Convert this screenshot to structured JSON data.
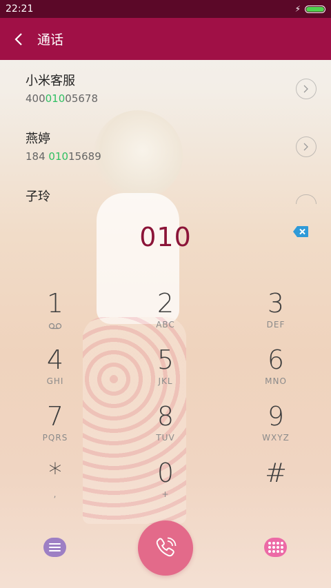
{
  "status_bar": {
    "time": "22:21",
    "charging_icon": "bolt-icon",
    "battery_icon": "battery-icon",
    "battery_color": "#4fd14f"
  },
  "title_bar": {
    "back_icon": "chevron-left-icon",
    "title": "通话",
    "color": "#a01046"
  },
  "results": [
    {
      "name": "小米客服",
      "number_pre": "400",
      "number_match": "010",
      "number_post": "05678"
    },
    {
      "name": "燕婷",
      "number_pre": "184 ",
      "number_match": "010",
      "number_post": "15689"
    },
    {
      "name": "子玲",
      "number_pre": "",
      "number_match": "",
      "number_post": ""
    }
  ],
  "dialer": {
    "digits": "010",
    "digits_color": "#8b1438",
    "backspace_icon": "backspace-icon"
  },
  "keypad": [
    {
      "num": "1",
      "sub": ""
    },
    {
      "num": "2",
      "sub": "ABC"
    },
    {
      "num": "3",
      "sub": "DEF"
    },
    {
      "num": "4",
      "sub": "GHI"
    },
    {
      "num": "5",
      "sub": "JKL"
    },
    {
      "num": "6",
      "sub": "MNO"
    },
    {
      "num": "7",
      "sub": "PQRS"
    },
    {
      "num": "8",
      "sub": "TUV"
    },
    {
      "num": "9",
      "sub": "WXYZ"
    },
    {
      "num": "*",
      "sub": ","
    },
    {
      "num": "0",
      "sub": "+"
    },
    {
      "num": "#",
      "sub": ""
    }
  ],
  "bottom_bar": {
    "menu_icon": "menu-icon",
    "call_icon": "phone-icon",
    "keypad_icon": "dialpad-icon",
    "call_color": "#e36a8a"
  }
}
